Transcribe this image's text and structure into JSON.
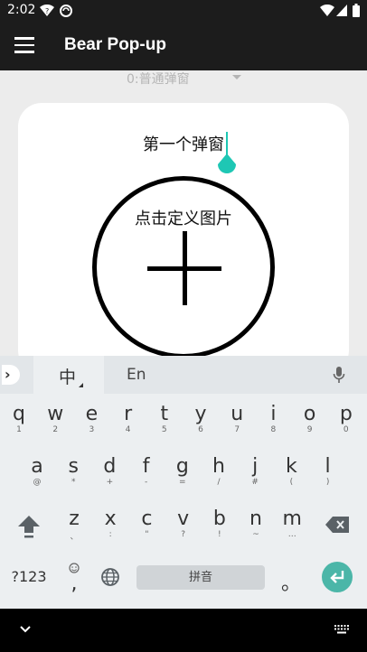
{
  "status_bar": {
    "time": "2:02"
  },
  "app_bar": {
    "title": "Bear Pop-up"
  },
  "spinner": {
    "selected": "0:普通弹窗"
  },
  "popup": {
    "title": "第一个弹窗",
    "image_label": "点击定义图片"
  },
  "keyboard": {
    "tabs": {
      "chinese": "中",
      "english": "En"
    },
    "row1": [
      {
        "m": "q",
        "s": "1"
      },
      {
        "m": "w",
        "s": "2"
      },
      {
        "m": "e",
        "s": "3"
      },
      {
        "m": "r",
        "s": "4"
      },
      {
        "m": "t",
        "s": "5"
      },
      {
        "m": "y",
        "s": "6"
      },
      {
        "m": "u",
        "s": "7"
      },
      {
        "m": "i",
        "s": "8"
      },
      {
        "m": "o",
        "s": "9"
      },
      {
        "m": "p",
        "s": "0"
      }
    ],
    "row2": [
      {
        "m": "a",
        "s": "@"
      },
      {
        "m": "s",
        "s": "*"
      },
      {
        "m": "d",
        "s": "+"
      },
      {
        "m": "f",
        "s": "-"
      },
      {
        "m": "g",
        "s": "="
      },
      {
        "m": "h",
        "s": "/"
      },
      {
        "m": "j",
        "s": "#"
      },
      {
        "m": "k",
        "s": "("
      },
      {
        "m": "l",
        "s": ")"
      }
    ],
    "row3": [
      {
        "m": "z",
        "s": "、"
      },
      {
        "m": "x",
        "s": ":"
      },
      {
        "m": "c",
        "s": "\""
      },
      {
        "m": "v",
        "s": "?"
      },
      {
        "m": "b",
        "s": "!"
      },
      {
        "m": "n",
        "s": "~"
      },
      {
        "m": "m",
        "s": "…"
      }
    ],
    "symbols_label": "?123",
    "comma": ",",
    "space_label": "拼音",
    "period": "。"
  },
  "colors": {
    "accent": "#1ec7b4",
    "enter": "#4bb6a8",
    "bar": "#1c1c1c"
  }
}
